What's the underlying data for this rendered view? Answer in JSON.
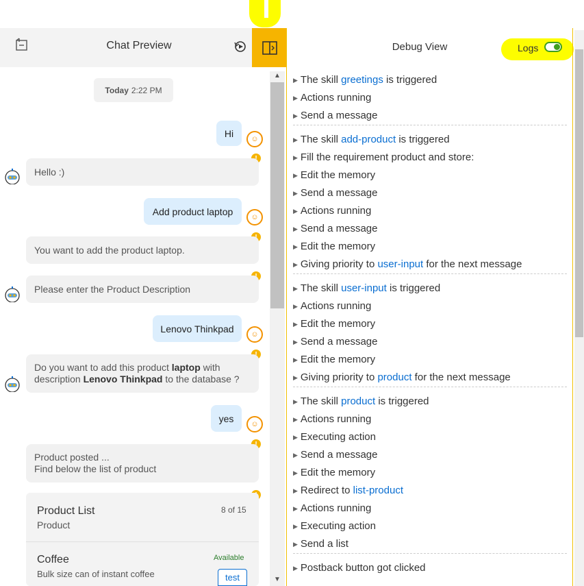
{
  "chat": {
    "title": "Chat Preview",
    "date_label": "Today",
    "date_time": "2:22 PM",
    "messages": [
      {
        "from": "user",
        "text": "Hi"
      },
      {
        "from": "bot",
        "text": "Hello :)"
      },
      {
        "from": "user",
        "text": "Add product laptop"
      },
      {
        "from": "bot",
        "text": "You want to add the product laptop."
      },
      {
        "from": "bot",
        "text": "Please enter the Product Description"
      },
      {
        "from": "user",
        "text": "Lenovo Thinkpad"
      },
      {
        "from": "bot",
        "parts": [
          "Do you want to add this product ",
          "laptop",
          " with",
          "description ",
          "Lenovo Thinkpad",
          " to the database ?"
        ]
      },
      {
        "from": "user",
        "text": "yes"
      },
      {
        "from": "bot",
        "lines": [
          "Product posted ...",
          "Find below the list of product"
        ]
      }
    ],
    "card": {
      "title": "Product List",
      "subtitle": "Product",
      "count": "8 of 15",
      "item_title": "Coffee",
      "item_desc": "Bulk size can of instant coffee",
      "item_status": "Available",
      "item_button": "test"
    },
    "colors": {
      "accent": "#f6b400",
      "user_bubble": "#dceefd",
      "bot_bubble": "#f1f1f1"
    }
  },
  "debug": {
    "title": "Debug View",
    "logs_label": "Logs",
    "logs_enabled": true,
    "groups": [
      [
        {
          "pre": "The skill ",
          "link": "greetings",
          "post": " is triggered"
        },
        {
          "pre": "Actions running"
        },
        {
          "pre": "Send a message"
        }
      ],
      [
        {
          "pre": "The skill ",
          "link": "add-product",
          "post": " is triggered"
        },
        {
          "pre": "Fill the requirement product and store:"
        },
        {
          "pre": "Edit the memory"
        },
        {
          "pre": "Send a message"
        },
        {
          "pre": "Actions running"
        },
        {
          "pre": "Send a message"
        },
        {
          "pre": "Edit the memory"
        },
        {
          "pre": "Giving priority to ",
          "link": "user-input",
          "post": " for the next message"
        }
      ],
      [
        {
          "pre": "The skill ",
          "link": "user-input",
          "post": " is triggered"
        },
        {
          "pre": "Actions running"
        },
        {
          "pre": "Edit the memory"
        },
        {
          "pre": "Send a message"
        },
        {
          "pre": "Edit the memory"
        },
        {
          "pre": "Giving priority to ",
          "link": "product",
          "post": " for the next message"
        }
      ],
      [
        {
          "pre": "The skill ",
          "link": "product",
          "post": " is triggered"
        },
        {
          "pre": "Actions running"
        },
        {
          "pre": "Executing action"
        },
        {
          "pre": "Send a message"
        },
        {
          "pre": "Edit the memory"
        },
        {
          "pre": "Redirect to ",
          "link": "list-product"
        },
        {
          "pre": "Actions running"
        },
        {
          "pre": "Executing action"
        },
        {
          "pre": "Send a list"
        }
      ],
      [
        {
          "pre": "Postback button got clicked"
        }
      ]
    ]
  }
}
